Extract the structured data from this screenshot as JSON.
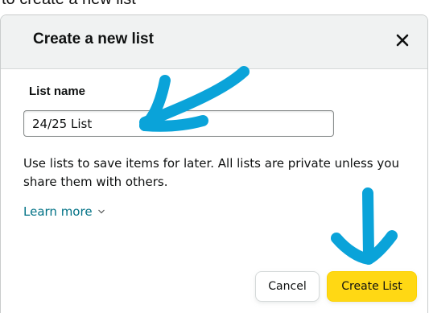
{
  "page_fragment": {
    "text": "to create a new list"
  },
  "dialog": {
    "title": "Create a new list",
    "close_label": "Close"
  },
  "form": {
    "list_name_label": "List name",
    "list_name_value": "24/25 List"
  },
  "helper_text": "Use lists to save items for later. All lists are private unless you share them with others.",
  "learn_more": "Learn more",
  "buttons": {
    "cancel": "Cancel",
    "create": "Create List"
  },
  "annotation": {
    "color": "#0aa3d9"
  },
  "colors": {
    "header_bg": "#f0f2f2",
    "link": "#007185",
    "primary_button": "#ffd814"
  }
}
